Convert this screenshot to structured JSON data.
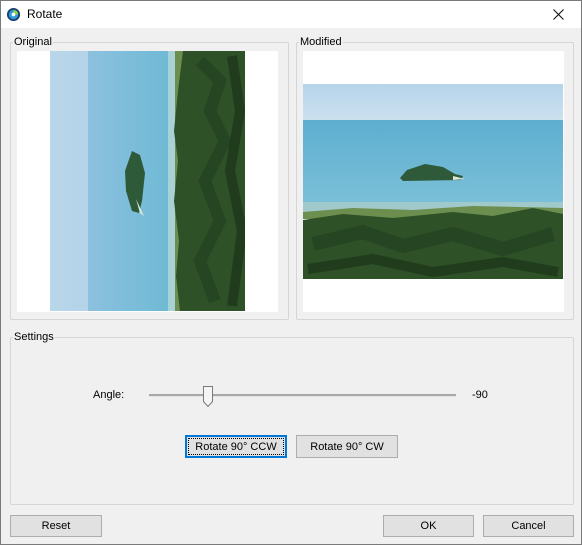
{
  "window": {
    "title": "Rotate"
  },
  "groups": {
    "original": "Original",
    "modified": "Modified",
    "settings": "Settings"
  },
  "settings": {
    "angle_label": "Angle:",
    "angle_value": "-90",
    "slider_min": -180,
    "slider_max": 180,
    "slider_value": -90
  },
  "buttons": {
    "rotate_ccw": "Rotate 90° CCW",
    "rotate_cw": "Rotate 90° CW",
    "reset": "Reset",
    "ok": "OK",
    "cancel": "Cancel"
  },
  "icons": {
    "app": "photo-app-icon",
    "close": "close-icon"
  },
  "colors": {
    "accent": "#0078d7",
    "sky": "#a9cde6",
    "sea": "#5fb3cf",
    "forest": "#2c4e26"
  }
}
